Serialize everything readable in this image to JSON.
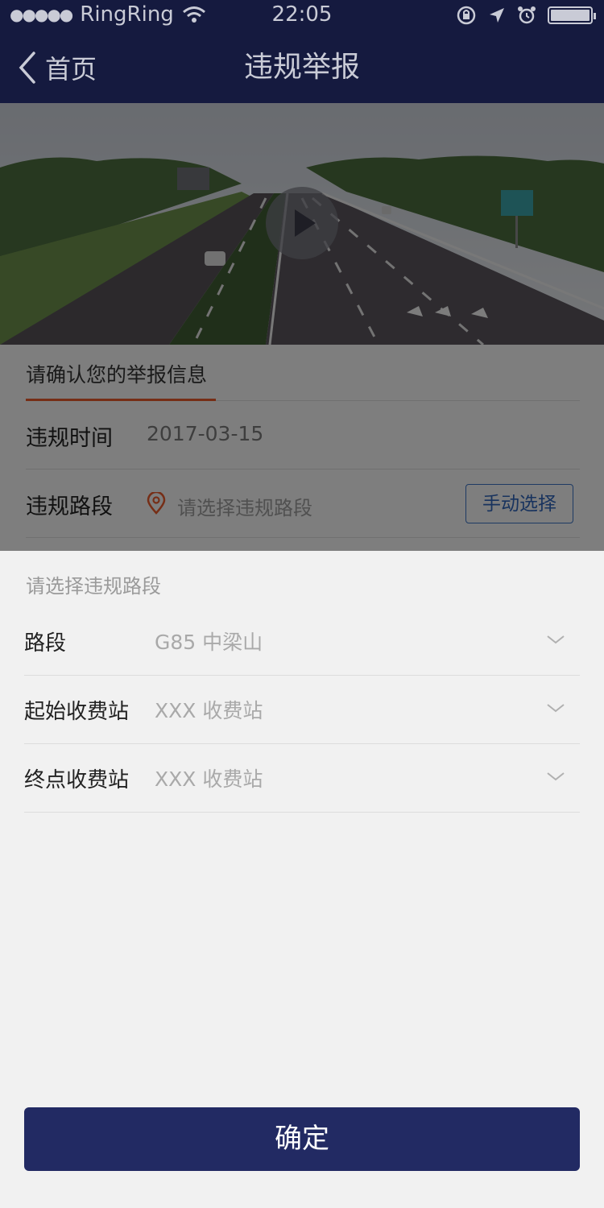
{
  "status_bar": {
    "signal_dots": "●●●●●",
    "carrier": "RingRing",
    "time": "22:05"
  },
  "nav": {
    "back_label": "首页",
    "title": "违规举报"
  },
  "form": {
    "section_title": "请确认您的举报信息",
    "time_label": "违规时间",
    "time_value": "2017-03-15",
    "road_label": "违规路段",
    "road_placeholder": "请选择违规路段",
    "manual_button": "手动选择"
  },
  "sheet": {
    "title": "请选择违规路段",
    "rows": [
      {
        "label": "路段",
        "value": "G85 中梁山"
      },
      {
        "label": "起始收费站",
        "value": "XXX 收费站"
      },
      {
        "label": "终点收费站",
        "value": "XXX 收费站"
      }
    ],
    "confirm_label": "确定"
  }
}
